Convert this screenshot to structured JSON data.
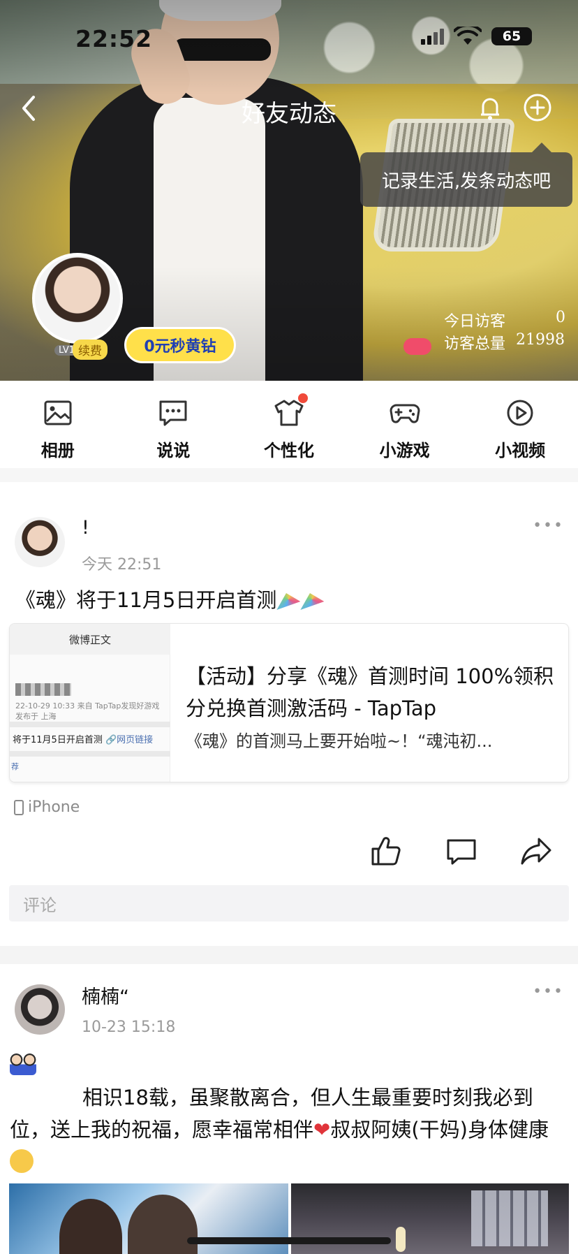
{
  "status_bar": {
    "time": "22:52",
    "battery": "65"
  },
  "header": {
    "title": "好友动态",
    "tooltip": "记录生活,发条动态吧",
    "level": "LV1",
    "renew_label": "续费",
    "vip_promo": "0元秒黄钻",
    "visitors_today_label": "今日访客",
    "visitors_today": "0",
    "visitors_total_label": "访客总量",
    "visitors_total": "21998"
  },
  "actions": [
    {
      "label": "相册",
      "icon": "image-icon"
    },
    {
      "label": "说说",
      "icon": "chat-bubble-icon"
    },
    {
      "label": "个性化",
      "icon": "tshirt-icon",
      "badge": true
    },
    {
      "label": "小游戏",
      "icon": "gamepad-icon"
    },
    {
      "label": "小视频",
      "icon": "play-circle-icon"
    }
  ],
  "posts": [
    {
      "author": "!",
      "time": "今天 22:51",
      "text": "《魂》将于11月5日开启首测",
      "link": {
        "thumb_header": "微博正文",
        "thumb_meta_1": "22-10-29 10:33 来自 TapTap发现好游戏",
        "thumb_meta_2": "发布于 上海",
        "thumb_text": "将于11月5日开启首测",
        "thumb_link": "网页链接",
        "thumb_foot": "荐",
        "title": "【活动】分享《魂》首测时间 100%领积分兑换首测激活码 - TapTap",
        "description": "《魂》的首测马上要开始啦~！“魂沌初..."
      },
      "device": "iPhone",
      "comment_placeholder": "评论"
    },
    {
      "author": "楠楠“",
      "time": "10-23 15:18",
      "text_part1": "相识18载，虽聚散离合，但人生最重要时刻我必到位，送上我的祝福，愿幸福常相伴",
      "text_part2": "叔叔阿姨(干妈)身体健康"
    }
  ]
}
